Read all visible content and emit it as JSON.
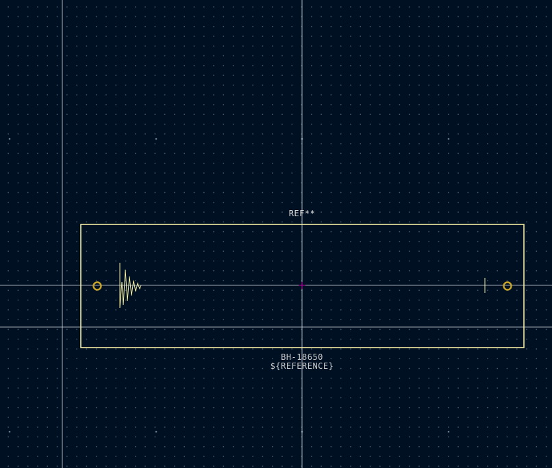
{
  "footprint": {
    "reference": "REF**",
    "value": "BH-18650",
    "fab_reference": "${REFERENCE}"
  },
  "colors": {
    "background": "#001023",
    "grid_dot": "#4a5968",
    "crosshair": "#e6e6e6",
    "silkscreen": "#f2eda1",
    "pad_ring": "#c8a428",
    "anchor": "#c000a0"
  },
  "icons": {
    "battery_plus": "plus-terminal-symbol",
    "battery_minus": "minus-terminal-symbol",
    "anchor": "footprint-anchor-icon"
  }
}
